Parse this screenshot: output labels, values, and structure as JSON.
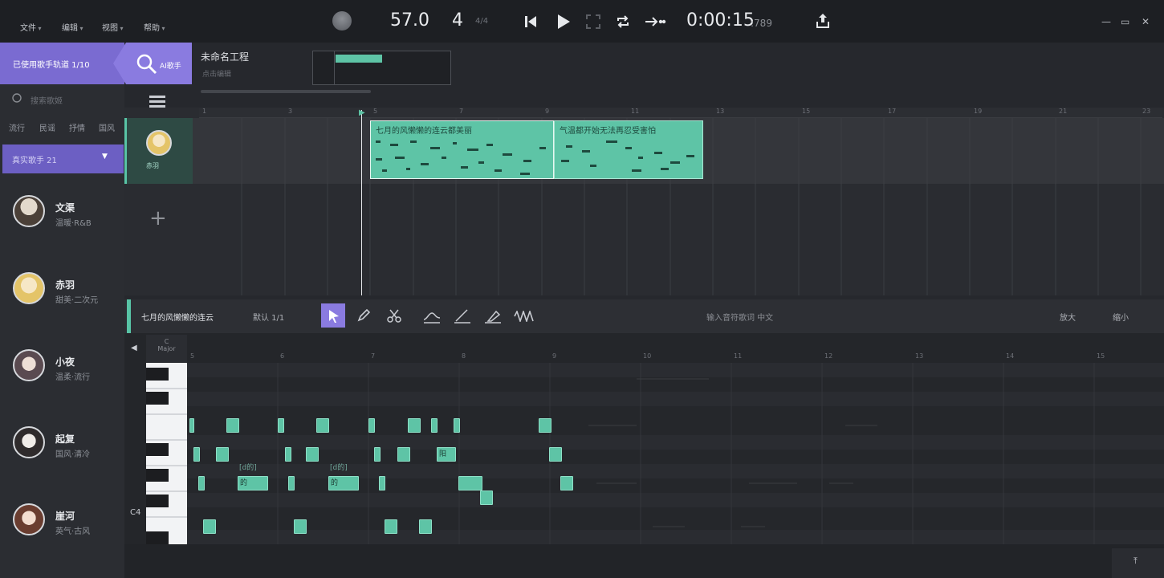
{
  "menu": [
    "文件",
    "编辑",
    "视图",
    "帮助"
  ],
  "transport": {
    "tempo": "57.0",
    "beats": "4",
    "time_sig": "4/4",
    "time": "0:00:15",
    "time_ms": ":789"
  },
  "sidebar": {
    "singer_count": "已使用歌手轨道 1/10",
    "ai_label": "AI歌手",
    "search_placeholder": "搜索歌姬",
    "filters": [
      "流行",
      "民谣",
      "抒情",
      "国风"
    ],
    "collab_label": "真实歌手 21",
    "singers": [
      {
        "name": "文渠",
        "desc": "温暖·R&B"
      },
      {
        "name": "赤羽",
        "desc": "甜美·二次元"
      },
      {
        "name": "小夜",
        "desc": "温柔·流行"
      },
      {
        "name": "起复",
        "desc": "国风·清冷"
      },
      {
        "name": "崖河",
        "desc": "英气·古风"
      }
    ]
  },
  "project": {
    "title": "未命名工程",
    "subtitle": "点击编辑"
  },
  "track": {
    "singer_name": "赤羽"
  },
  "ruler": {
    "marks": [
      "1",
      "3",
      "5",
      "7",
      "9",
      "11",
      "13",
      "15",
      "17",
      "19",
      "21",
      "23"
    ]
  },
  "clips": [
    {
      "label": "七月的风懒懒的连云都美丽"
    },
    {
      "label": "气温都开始无法再忍受害怕"
    }
  ],
  "editor": {
    "clip_name": "七月的风懒懒的连云",
    "dropdown": "默认 1/1",
    "hint": "输入音符歌词 中文",
    "zoom_in": "放大",
    "zoom_out": "缩小",
    "ruler_marks": [
      "5",
      "6",
      "7",
      "8",
      "9",
      "10",
      "11",
      "12",
      "13",
      "14",
      "15"
    ],
    "key_label": "C4",
    "mode": "Major"
  },
  "notes": [
    {
      "lyric": ""
    },
    {
      "lyric": ""
    },
    {
      "lyric": ""
    },
    {
      "lyric": ""
    },
    {
      "lyric": "的"
    },
    {
      "lyric": "的"
    },
    {
      "lyric": "阳"
    },
    {
      "lyric": ""
    },
    {
      "lyric": ""
    }
  ],
  "lyric_tags": [
    "[d的]",
    "[d的]"
  ]
}
